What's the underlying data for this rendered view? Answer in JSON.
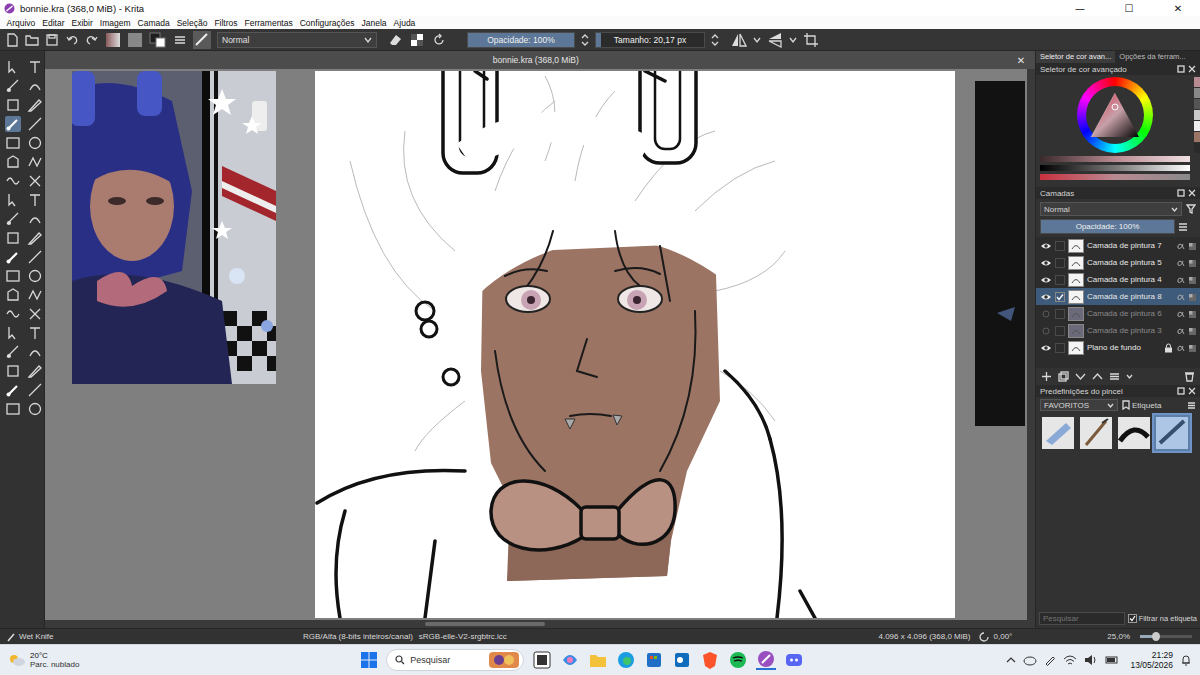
{
  "window": {
    "title": "bonnie.kra (368,0 MiB) - Krita",
    "controls": [
      "—",
      "☐",
      "✕"
    ]
  },
  "menu": [
    "Arquivo",
    "Editar",
    "Exibir",
    "Imagem",
    "Camada",
    "Seleção",
    "Filtros",
    "Ferramentas",
    "Configurações",
    "Janela",
    "Ajuda"
  ],
  "toolbar": {
    "blend_mode": "Normal",
    "opacity": {
      "label": "Opacidade: 100%",
      "level": 1
    },
    "size": {
      "label": "Tamanho: 20,17 px",
      "level": 0.05
    }
  },
  "toolbox": {
    "tools": [
      {
        "selected": false
      },
      {
        "selected": false
      },
      {
        "selected": false
      },
      {
        "selected": false
      },
      {
        "selected": false
      },
      {
        "selected": false
      },
      {
        "selected": true
      },
      {
        "selected": false
      },
      {
        "selected": false
      },
      {
        "selected": false
      },
      {
        "selected": false
      },
      {
        "selected": false
      },
      {
        "selected": false
      },
      {
        "selected": false
      },
      {
        "selected": false
      },
      {
        "selected": false
      },
      {
        "selected": false
      },
      {
        "selected": false
      },
      {
        "selected": false
      },
      {
        "selected": false
      },
      {
        "selected": false
      },
      {
        "selected": false
      },
      {
        "selected": false
      },
      {
        "selected": false
      },
      {
        "selected": false
      },
      {
        "selected": false
      },
      {
        "selected": false
      },
      {
        "selected": false
      },
      {
        "selected": false
      },
      {
        "selected": false
      },
      {
        "selected": false
      },
      {
        "selected": false
      },
      {
        "selected": false
      },
      {
        "selected": false
      },
      {
        "selected": false
      },
      {
        "selected": false
      },
      {
        "selected": false
      },
      {
        "selected": false
      }
    ]
  },
  "document": {
    "title": "bonnie.kra (368,0 MiB)",
    "close": "✕"
  },
  "docker_tabs": [
    {
      "label": "Seletor de cor avan...",
      "selected": true
    },
    {
      "label": "Opções da ferram...",
      "selected": false
    }
  ],
  "color_selector": {
    "title": "Seletor de cor avançado"
  },
  "layers": {
    "title": "Camadas",
    "blend_mode": "Normal",
    "opacity": {
      "label": "Opacidade: 100%",
      "level": 1
    },
    "items": [
      {
        "name": "Camada de pintura 7",
        "visible": true,
        "selected": false,
        "locked": false
      },
      {
        "name": "Camada de pintura 5",
        "visible": true,
        "selected": false,
        "locked": false
      },
      {
        "name": "Camada de pintura 4",
        "visible": true,
        "selected": false,
        "locked": false
      },
      {
        "name": "Camada de pintura 8",
        "visible": true,
        "selected": true,
        "locked": false
      },
      {
        "name": "Camada de pintura 6",
        "visible": false,
        "selected": false,
        "locked": false
      },
      {
        "name": "Camada de pintura 3",
        "visible": false,
        "selected": false,
        "locked": false
      },
      {
        "name": "Plano de fundo",
        "visible": true,
        "selected": false,
        "locked": true
      }
    ]
  },
  "brush_presets": {
    "title": "Predefinições do pincel",
    "tag": "FAVORITOS",
    "tag_button": "Etiqueta",
    "presets": [
      {
        "selected": false
      },
      {
        "selected": false
      },
      {
        "selected": false
      },
      {
        "selected": true
      }
    ],
    "search": {
      "placeholder": "Pesquisar"
    },
    "filter": {
      "label": "Filtrar na etiqueta",
      "checked": true
    }
  },
  "status_bar": {
    "brush": "Wet Knife",
    "color_model": "RGB/Alfa (8-bits inteiros/canal)",
    "profile": "sRGB-elle-V2-srgbtrc.icc",
    "image_size": "4.096 x 4.096 (368,0 MiB)",
    "rotation": "0,00°",
    "zoom": "25,0%",
    "zoom_level": 0.3
  },
  "taskbar": {
    "weather": {
      "temperature": "20°C",
      "condition": "Parc. nublado"
    },
    "search": {
      "placeholder": "Pesquisar"
    },
    "time": "21:29",
    "date": "13/05/2026"
  }
}
